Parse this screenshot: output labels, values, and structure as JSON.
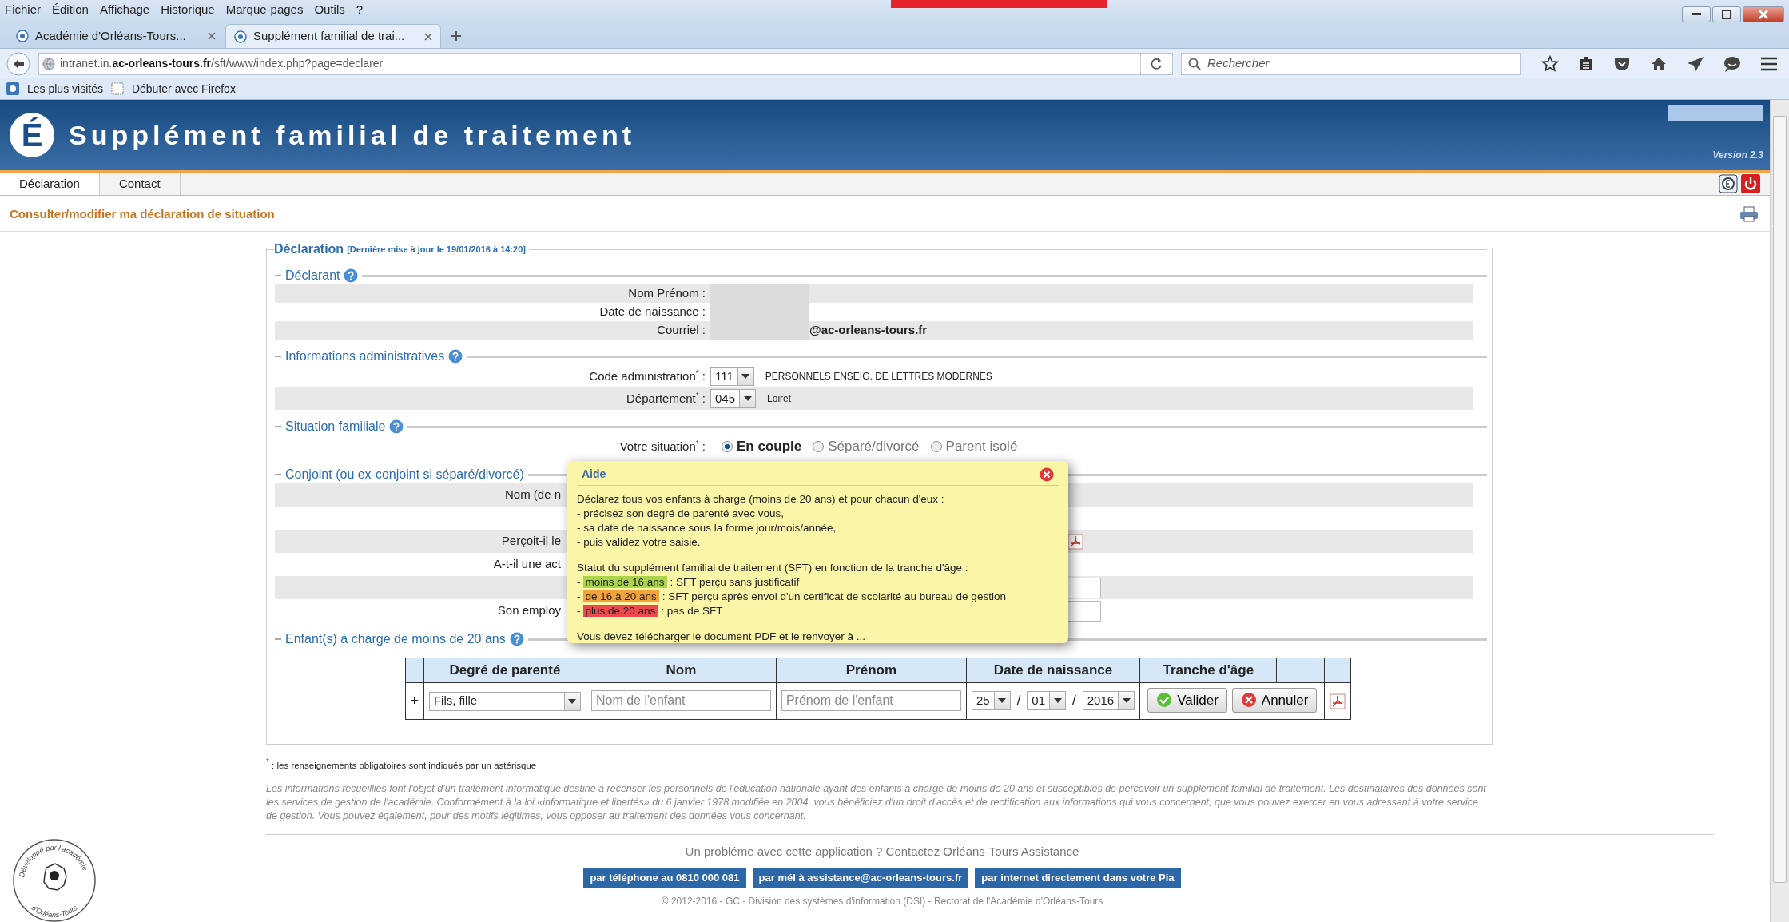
{
  "browser": {
    "menu": [
      "Fichier",
      "Édition",
      "Affichage",
      "Historique",
      "Marque-pages",
      "Outils",
      "?"
    ],
    "tabs": [
      {
        "label": "Académie d'Orléans-Tours...",
        "selected": false
      },
      {
        "label": "Supplément familial de trai...",
        "selected": true
      }
    ],
    "url": "intranet.in.**ac-orleans-tours.fr**/sft/www/index.php?page=declarer",
    "search": {
      "placeholder": "Rechercher"
    },
    "bookmarks": [
      "Les plus visités",
      "Débuter avec Firefox"
    ]
  },
  "app": {
    "logo_letter": "É",
    "title": "Supplément familial de traitement",
    "version": "Version 2.3",
    "nav": [
      {
        "label": "Déclaration",
        "selected": true
      },
      {
        "label": "Contact",
        "selected": false
      }
    ]
  },
  "page_title": "Consulter/modifier ma déclaration de situation",
  "declaration": {
    "legend": "Déclaration",
    "updated": "[Dernière mise à jour le 19/01/2016 à 14:20]",
    "sections": [
      {
        "kind": "info",
        "legend": "Déclarant",
        "rows": [
          {
            "label": "Nom Prénom :",
            "redacted": true
          },
          {
            "label": "Date de naissance :",
            "redacted": true
          },
          {
            "label": "Courriel :",
            "redacted": true,
            "value": "@ac-orleans-tours.fr"
          }
        ]
      },
      {
        "kind": "select",
        "legend": "Informations administratives",
        "rows": [
          {
            "label": "Code administration$^{*}$ :",
            "value": "111",
            "description": "PERSONNELS ENSEIG. DE LETTRES MODERNES"
          },
          {
            "label": "Département$^{*}$ :",
            "value": "045",
            "description": "Loiret"
          }
        ]
      },
      {
        "kind": "radio",
        "legend": "Situation familiale",
        "label": "Votre situation$^{*}$ :",
        "options": [
          {
            "label": "En couple",
            "selected": true
          },
          {
            "label": "Séparé/divorcé",
            "selected": false
          },
          {
            "label": "Parent isolé",
            "selected": false
          }
        ]
      },
      {
        "kind": "partial",
        "legend": "Conjoint (ou ex-conjoint si séparé/divorcé)",
        "rows": [
          {
            "label": "Nom (de n",
            "kind": "text"
          },
          {
            "kind": "blank"
          },
          {
            "label": "Perçoit-il le",
            "kind": "pdf"
          },
          {
            "label": "A-t-il une act",
            "kind": "text"
          },
          {
            "kind": "input"
          },
          {
            "label": "Son employ",
            "kind": "input"
          }
        ]
      },
      {
        "kind": "table",
        "legend": "Enfant(s) à charge de moins de 20 ans",
        "columns": [
          "Degré de parenté",
          "Nom",
          "Prénom",
          "Date de naissance",
          "Tranche d'âge"
        ],
        "row": {
          "add": "+",
          "relation": "Fils, fille",
          "name_placeholder": "Nom de l'enfant",
          "firstname_placeholder": "Prénom de l'enfant",
          "day": "25",
          "month": "01",
          "year": "2016",
          "separators": [
            "/",
            "/"
          ],
          "buttons": [
            {
              "label": "Valider",
              "kind": "ok"
            },
            {
              "label": "Annuler",
              "kind": "cancel"
            }
          ]
        }
      }
    ]
  },
  "help": {
    "title": "Aide",
    "lines": [
      {
        "kind": "text",
        "text": "Déclarez tous vos enfants à charge (moins de 20 ans) et pour chacun d'eux :"
      },
      {
        "kind": "text",
        "text": "- précisez son degré de parenté avec vous,"
      },
      {
        "kind": "text",
        "text": "- sa date de naissance sous la forme jour/mois/année,"
      },
      {
        "kind": "text",
        "text": "- puis validez votre saisie."
      },
      {
        "kind": "gap"
      },
      {
        "kind": "text",
        "text": "Statut du supplément familial de traitement (SFT) en fonction de la tranche d'âge :"
      },
      {
        "kind": "tag",
        "lead": "-",
        "tag": "moins de 16 ans",
        "color": "#a9d54a",
        "rest": ": SFT perçu sans justificatif"
      },
      {
        "kind": "tag",
        "lead": "-",
        "tag": "de 16 à 20 ans",
        "color": "#f2a33a",
        "rest": ": SFT perçu après envoi d'un certificat de scolarité au bureau de gestion"
      },
      {
        "kind": "tag",
        "lead": "-",
        "tag": "plus de 20 ans",
        "color": "#ec4a4f",
        "rest": ": pas de SFT"
      },
      {
        "kind": "gap"
      },
      {
        "kind": "text",
        "text": "Vous devez télécharger le document PDF et le renvoyer à ..."
      }
    ]
  },
  "footer": {
    "note": "$^{*}$ : les renseignements obligatoires sont indiqués par un astérisque",
    "legal": "Les informations recueillies font l'objet d'un traitement informatique destiné à recenser les personnels de l'éducation nationale ayant des enfants à charge de moins de 20 ans et susceptibles de percevoir un supplément familial de traitement. Les destinataires des données sont les services de gestion de l'académie. Conformément à la loi «informatique et libertés» du 6 janvier 1978 modifiée en 2004, vous bénéficiez d'un droit d'accès et de rectification aux informations qui vous concernent, que vous pouvez exercer en vous adressant à votre service de gestion. Vous pouvez également, pour des motifs légitimes, vous opposer au traitement des données vous concernant.",
    "logo_top": "Développé par l'académie",
    "logo_bottom": "d'Orléans-Tours",
    "contact": "Un probléme avec cette application ? Contactez Orléans-Tours Assistance",
    "links": [
      "par téléphone au 0810 000 081",
      "par mél à assistance@ac-orleans-tours.fr",
      "par internet directement dans votre Pia"
    ],
    "copyright": "© 2012-2016 - GC - Division des systèmes d'information (DSI) - Rectorat de l'Académie d'Orléans-Tours"
  }
}
